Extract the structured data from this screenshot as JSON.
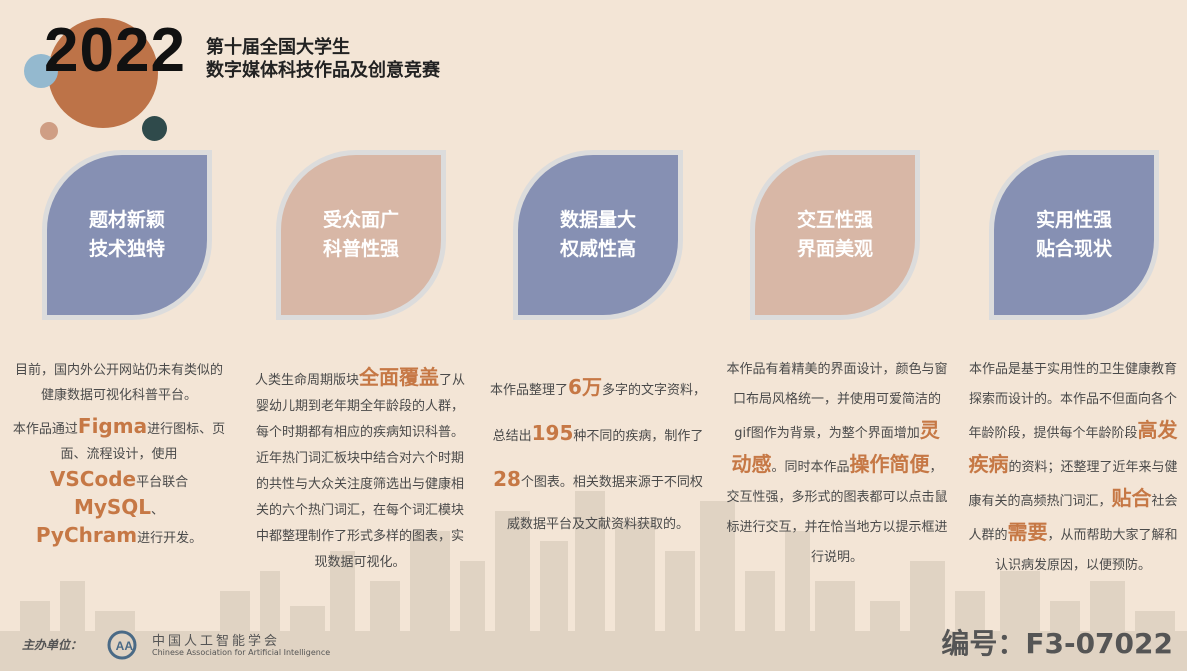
{
  "header": {
    "year": "2022",
    "subtitle_line1": "第十届全国大学生",
    "subtitle_line2": "数字媒体科技作品及创意竞赛"
  },
  "colors": {
    "background": "#f3e5d6",
    "leaf_blue": "#8690b3",
    "leaf_pink": "#d8b7a6",
    "highlight": "#c67845"
  },
  "cards": [
    {
      "line1": "题材新颖",
      "line2": "技术独特"
    },
    {
      "line1": "受众面广",
      "line2": "科普性强"
    },
    {
      "line1": "数据量大",
      "line2": "权威性高"
    },
    {
      "line1": "交互性强",
      "line2": "界面美观"
    },
    {
      "line1": "实用性强",
      "line2": "贴合现状"
    }
  ],
  "descriptions": {
    "d1": {
      "p1": "目前，国内外公开网站仍未有类似的健康数据可视化科普平台。",
      "a": "本作品通过",
      "hl1": "Figma",
      "b": "进行图标、页面、流程设计，使用",
      "hl2": "VSCode",
      "c": "平台联合",
      "hl3": "MySQL",
      "d": "、",
      "hl4": "PyChram",
      "e": "进行开发。"
    },
    "d2": {
      "a": "人类生命周期版块",
      "hl1": "全面覆盖",
      "b": "了从婴幼儿期到老年期全年龄段的人群，每个时期都有相应的疾病知识科普。近年热门词汇板块中结合对六个时期的共性与大众关注度筛选出与健康相关的六个热门词汇，在每个词汇模块中都整理制作了形式多样的图表，实现数据可视化。"
    },
    "d3": {
      "a": "本作品整理了",
      "hl1": "6万",
      "b": "多字的文字资料，总结出",
      "hl2": "195",
      "c": "种不同的疾病，制作了",
      "hl3": "28",
      "d": "个图表。相关数据来源于不同权威数据平台及文献资料获取的。"
    },
    "d4": {
      "a": "本作品有着精美的界面设计，颜色与窗口布局风格统一，并使用可爱简洁的gif图作为背景，为整个界面增加",
      "hl1": "灵动感",
      "b": "。同时本作品",
      "hl2": "操作简便",
      "c": "，交互性强，多形式的图表都可以点击鼠标进行交互，并在恰当地方以提示框进行说明。"
    },
    "d5": {
      "a": "本作品是基于实用性的卫生健康教育探索而设计的。本作品不但面向各个年龄阶段，提供每个年龄阶段",
      "hl1": "高发疾病",
      "b": "的资料；还整理了近年来与健康有关的高频热门词汇，",
      "hl2": "贴合",
      "c": "社会人群的",
      "hl3": "需要",
      "d": "，从而帮助大家了解和认识病发原因，以便预防。"
    }
  },
  "footer": {
    "organizer_label": "主办单位：",
    "logo_text": "AAI",
    "org_cn": "中国人工智能学会",
    "org_en": "Chinese Association for Artificial Intelligence",
    "code": "编号：F3-07022"
  }
}
